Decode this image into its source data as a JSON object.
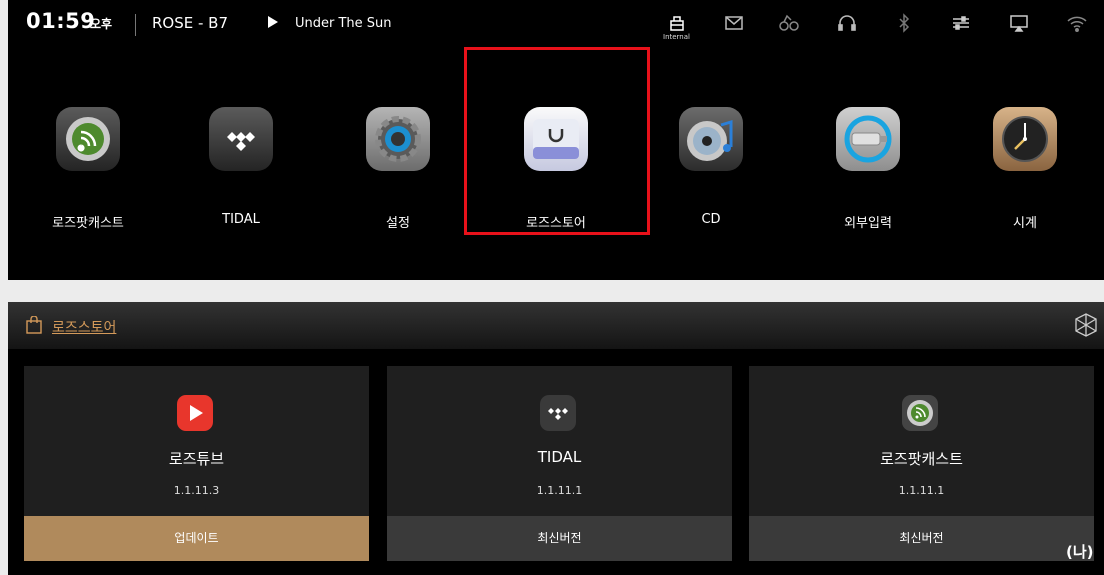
{
  "status_bar": {
    "time": "01:59",
    "ampm": "오후",
    "device": "ROSE - B7",
    "track": "Under The Sun",
    "internal_label": "Internal",
    "icons": [
      "internal-storage-icon",
      "mail-icon",
      "shopping-icon",
      "headphones-icon",
      "bluetooth-icon",
      "equalizer-icon",
      "airplay-icon",
      "wifi-icon"
    ]
  },
  "home_apps": [
    {
      "label": "로즈팟캐스트",
      "icon": "podcast-icon"
    },
    {
      "label": "TIDAL",
      "icon": "tidal-icon"
    },
    {
      "label": "설정",
      "icon": "settings-gear-icon"
    },
    {
      "label": "로즈스토어",
      "icon": "store-bag-icon"
    },
    {
      "label": "CD",
      "icon": "cd-icon"
    },
    {
      "label": "외부입력",
      "icon": "external-input-icon"
    },
    {
      "label": "시계",
      "icon": "clock-icon"
    }
  ],
  "highlight_color": "#e8111a",
  "store": {
    "title": "로즈스토어",
    "accent": "#d49a5a",
    "cards": [
      {
        "name": "로즈튜브",
        "version": "1.1.11.3",
        "button": "업데이트",
        "icon": "rosetube-play-icon"
      },
      {
        "name": "TIDAL",
        "version": "1.1.11.1",
        "button": "최신버전",
        "icon": "tidal-icon"
      },
      {
        "name": "로즈팟캐스트",
        "version": "1.1.11.1",
        "button": "최신버전",
        "icon": "podcast-icon"
      }
    ],
    "update_color": "#b08a5c"
  },
  "caption": "(나)"
}
